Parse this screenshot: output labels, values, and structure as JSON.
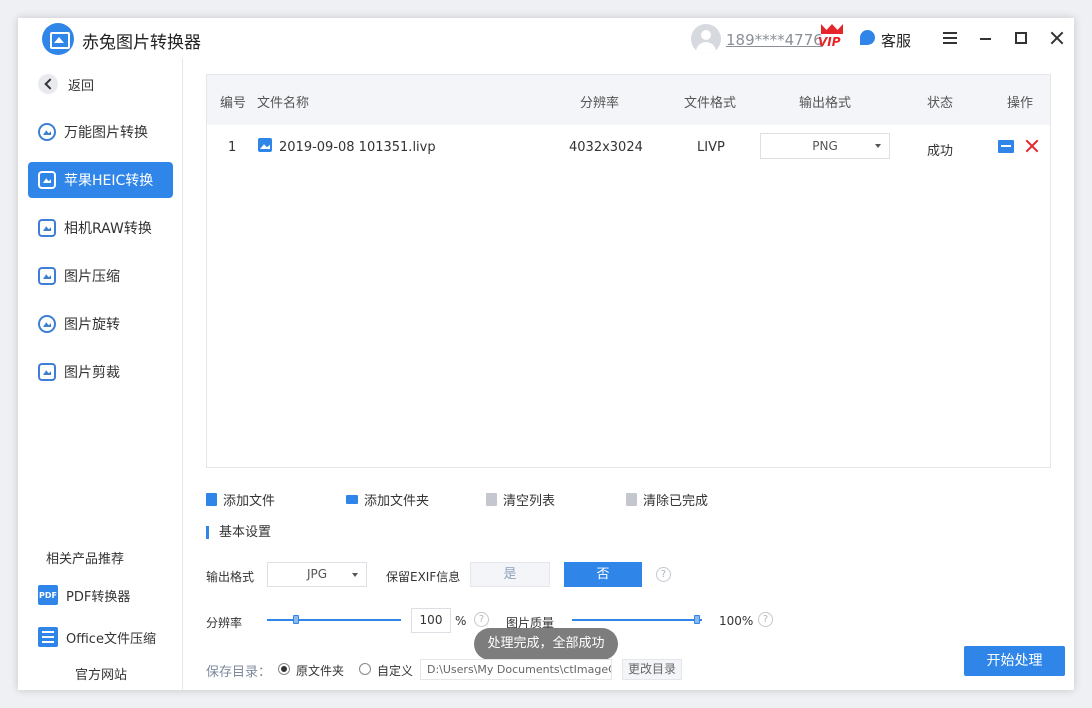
{
  "app": {
    "title": "赤兔图片转换器"
  },
  "header": {
    "user": "189****4776",
    "vip": "VIP",
    "service": "客服"
  },
  "sidebar": {
    "back": "返回",
    "items": [
      {
        "label": "万能图片转换"
      },
      {
        "label": "苹果HEIC转换"
      },
      {
        "label": "相机RAW转换"
      },
      {
        "label": "图片压缩"
      },
      {
        "label": "图片旋转"
      },
      {
        "label": "图片剪裁"
      }
    ],
    "related_title": "相关产品推荐",
    "products": [
      {
        "label": "PDF转换器",
        "icon_text": "PDF"
      },
      {
        "label": "Office文件压缩"
      }
    ],
    "site": "官方网站"
  },
  "table": {
    "headers": [
      "编号",
      "文件名称",
      "分辨率",
      "文件格式",
      "输出格式",
      "状态",
      "操作"
    ],
    "rows": [
      {
        "no": "1",
        "name": "2019-09-08 101351.livp",
        "resolution": "4032x3024",
        "format": "LIVP",
        "output": "PNG",
        "status": "成功"
      }
    ]
  },
  "toolbar": {
    "add_file": "添加文件",
    "add_folder": "添加文件夹",
    "clear_list": "清空列表",
    "clear_done": "清除已完成"
  },
  "settings": {
    "title": "基本设置",
    "output_format_label": "输出格式",
    "output_format": "JPG",
    "exif_label": "保留EXIF信息",
    "exif_yes": "是",
    "exif_no": "否",
    "resolution_label": "分辨率",
    "resolution_value": "100",
    "resolution_unit": "%",
    "quality_label": "图片质量",
    "quality_value": "100%",
    "help": "?"
  },
  "toast": "处理完成，全部成功",
  "save": {
    "label": "保存目录：",
    "option_original": "原文件夹",
    "option_custom": "自定义",
    "path": "D:\\Users\\My Documents\\ctImageC",
    "change": "更改目录"
  },
  "start_button": "开始处理",
  "colors": {
    "accent": "#2f86e8",
    "danger": "#e5252a"
  }
}
